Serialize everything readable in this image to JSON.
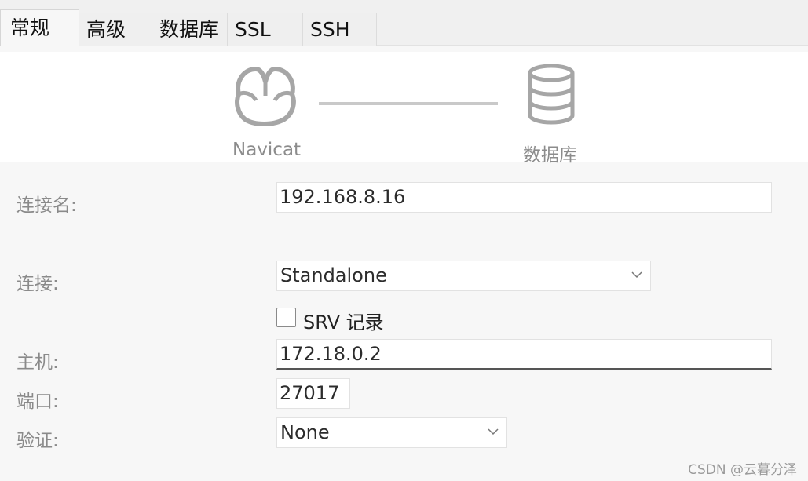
{
  "tabs": [
    {
      "label": "常规",
      "active": true
    },
    {
      "label": "高级",
      "active": false
    },
    {
      "label": "数据库",
      "active": false
    },
    {
      "label": "SSL",
      "active": false
    },
    {
      "label": "SSH",
      "active": false
    }
  ],
  "banner": {
    "left_label": "Navicat",
    "right_label": "数据库",
    "left_icon": "navicat-logo-icon",
    "right_icon": "database-icon"
  },
  "form": {
    "connection_name": {
      "label": "连接名:",
      "value": "192.168.8.16"
    },
    "connection": {
      "label": "连接:",
      "value": "Standalone"
    },
    "srv": {
      "label": "SRV 记录",
      "checked": false
    },
    "host": {
      "label": "主机:",
      "value": "172.18.0.2"
    },
    "port": {
      "label": "端口:",
      "value": "27017"
    },
    "auth": {
      "label": "验证:",
      "value": "None"
    }
  },
  "watermark": "CSDN @云暮分泽",
  "colors": {
    "icon_gray": "#a6a6a6",
    "label_gray": "#8a8a8a",
    "background": "#f7f7f7"
  }
}
